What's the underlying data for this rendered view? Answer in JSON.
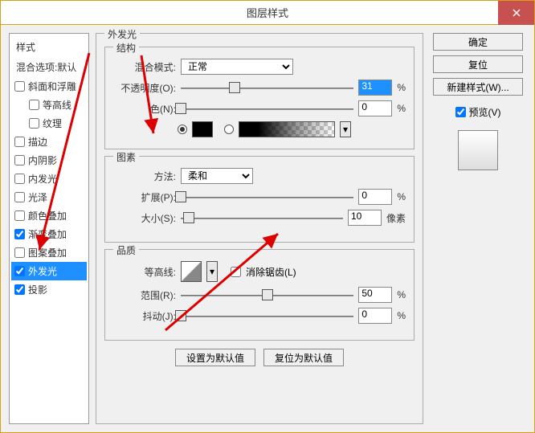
{
  "window": {
    "title": "图层样式"
  },
  "left": {
    "header1": "样式",
    "header2": "混合选项:默认",
    "items": [
      {
        "label": "斜面和浮雕",
        "checked": false,
        "indent": false
      },
      {
        "label": "等高线",
        "checked": false,
        "indent": true
      },
      {
        "label": "纹理",
        "checked": false,
        "indent": true
      },
      {
        "label": "描边",
        "checked": false,
        "indent": false
      },
      {
        "label": "内阴影",
        "checked": false,
        "indent": false
      },
      {
        "label": "内发光",
        "checked": false,
        "indent": false
      },
      {
        "label": "光泽",
        "checked": false,
        "indent": false
      },
      {
        "label": "颜色叠加",
        "checked": false,
        "indent": false
      },
      {
        "label": "渐变叠加",
        "checked": true,
        "indent": false
      },
      {
        "label": "图案叠加",
        "checked": false,
        "indent": false
      },
      {
        "label": "外发光",
        "checked": true,
        "indent": false,
        "selected": true
      },
      {
        "label": "投影",
        "checked": true,
        "indent": false
      }
    ]
  },
  "outer_glow": {
    "title": "外发光",
    "structure": {
      "title": "结构",
      "blend_label": "混合模式:",
      "blend_value": "正常",
      "opacity_label": "不透明度(O):",
      "opacity_value": "31",
      "opacity_unit": "%",
      "color_label": "色(N):",
      "color_value": "0",
      "color_unit": "%"
    },
    "elements": {
      "title": "图素",
      "method_label": "方法:",
      "method_value": "柔和",
      "spread_label": "扩展(P):",
      "spread_value": "0",
      "spread_unit": "%",
      "size_label": "大小(S):",
      "size_value": "10",
      "size_unit": "像素"
    },
    "quality": {
      "title": "品质",
      "contour_label": "等高线:",
      "antialias_label": "消除锯齿(L)",
      "range_label": "范围(R):",
      "range_value": "50",
      "range_unit": "%",
      "jitter_label": "抖动(J):",
      "jitter_value": "0",
      "jitter_unit": "%"
    },
    "buttons": {
      "default": "设置为默认值",
      "reset": "复位为默认值"
    }
  },
  "right": {
    "ok": "确定",
    "cancel": "复位",
    "new_style": "新建样式(W)...",
    "preview_label": "预览(V)"
  }
}
